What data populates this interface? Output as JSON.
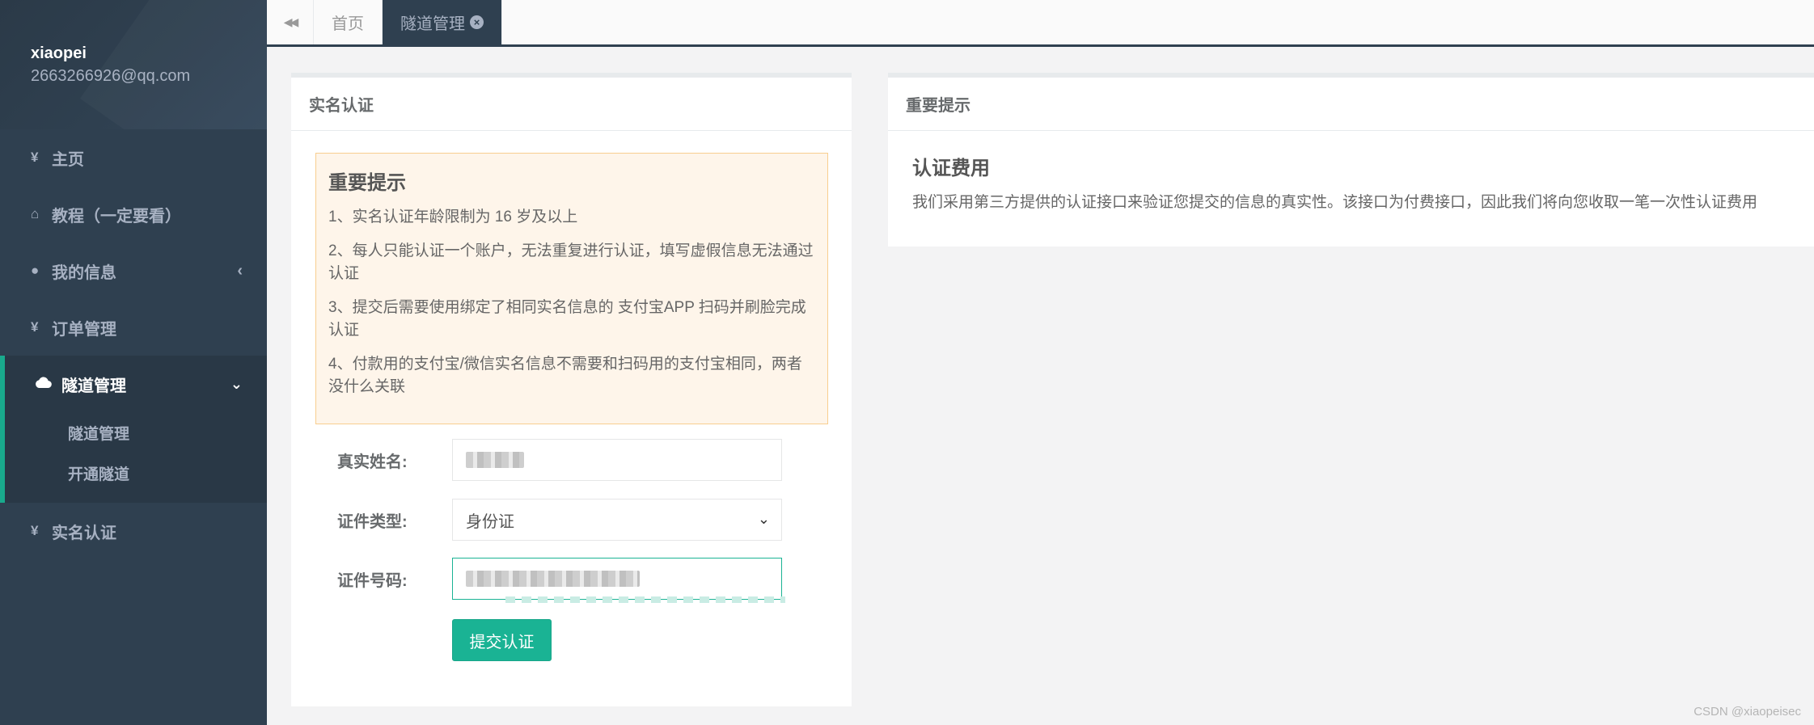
{
  "sidebar": {
    "username": "xiaopei",
    "email": "2663266926@qq.com",
    "items": [
      {
        "icon": "yen-icon",
        "glyph": "¥",
        "label": "主页"
      },
      {
        "icon": "home-icon",
        "glyph": "⌂",
        "label": "教程（一定要看）"
      },
      {
        "icon": "user-icon",
        "glyph": "●",
        "label": "我的信息",
        "chevron": "‹"
      },
      {
        "icon": "yen-icon",
        "glyph": "¥",
        "label": "订单管理"
      }
    ],
    "active": {
      "icon": "cloud-icon",
      "label": "隧道管理",
      "chevron": "⌄",
      "children": [
        "隧道管理",
        "开通隧道"
      ]
    },
    "last": {
      "icon": "yen-icon",
      "glyph": "¥",
      "label": "实名认证"
    }
  },
  "topbar": {
    "back_glyph": "◀◀",
    "tabs": [
      {
        "label": "首页",
        "active": false
      },
      {
        "label": "隧道管理",
        "active": true,
        "close_glyph": "×"
      }
    ]
  },
  "left_panel": {
    "title": "实名认证",
    "notice": {
      "heading": "重要提示",
      "items": [
        "1、实名认证年龄限制为 16 岁及以上",
        "2、每人只能认证一个账户，无法重复进行认证，填写虚假信息无法通过认证",
        "3、提交后需要使用绑定了相同实名信息的 支付宝APP 扫码并刷脸完成认证",
        "4、付款用的支付宝/微信实名信息不需要和扫码用的支付宝相同，两者没什么关联"
      ]
    },
    "form": {
      "name_label": "真实姓名:",
      "type_label": "证件类型:",
      "type_value": "身份证",
      "id_label": "证件号码:",
      "submit_label": "提交认证"
    }
  },
  "right_panel": {
    "title": "重要提示",
    "heading": "认证费用",
    "text": "我们采用第三方提供的认证接口来验证您提交的信息的真实性。该接口为付费接口，因此我们将向您收取一笔一次性认证费用"
  },
  "watermark": "CSDN @xiaopeisec",
  "colors": {
    "sidebar": "#2f4050",
    "accent": "#1ab394",
    "notice_bg": "#fef5ea",
    "notice_border": "#f8ce8f"
  }
}
